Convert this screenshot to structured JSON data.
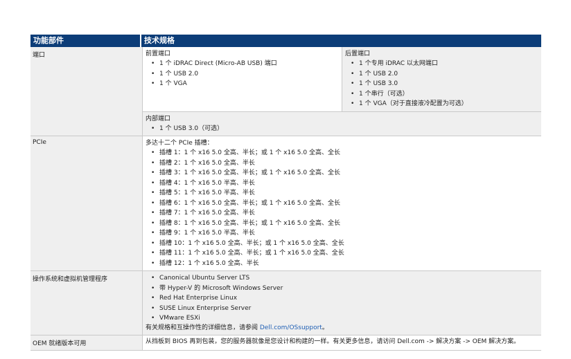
{
  "table": {
    "header": {
      "col1": "功能部件",
      "col2": "技术规格"
    },
    "ports": {
      "label": "端口",
      "front": {
        "title": "前置端口",
        "items": [
          "1 个 iDRAC Direct (Micro-AB USB) 端口",
          "1 个 USB 2.0",
          "1 个 VGA"
        ]
      },
      "rear": {
        "title": "后置端口",
        "items": [
          "1 个专用 iDRAC 以太网端口",
          "1 个 USB 2.0",
          "1 个 USB 3.0",
          "1 个串行（可选）",
          "1 个 VGA（对于直接液冷配置为可选）"
        ]
      },
      "internal": {
        "title": "内部端口",
        "items": [
          "1 个 USB 3.0（可选）"
        ]
      }
    },
    "pcie": {
      "label": "PCIe",
      "intro": "多达十二个 PCIe 插槽：",
      "slots": [
        "插槽 1：1 个 x16 5.0 全高、半长；或 1 个 x16 5.0 全高、全长",
        "插槽 2：1 个 x16 5.0 全高、半长",
        "插槽 3：1 个 x16 5.0 全高、半长；或 1 个 x16 5.0 全高、全长",
        "插槽 4：1 个 x16 5.0 半高、半长",
        "插槽 5：1 个 x16 5.0 半高、半长",
        "插槽 6：1 个 x16 5.0 全高、半长；或 1 个 x16 5.0 全高、全长",
        "插槽 7：1 个 x16 5.0 全高、半长",
        "插槽 8：1 个 x16 5.0 全高、半长；或 1 个 x16 5.0 全高、全长",
        "插槽 9：1 个 x16 5.0 半高、半长",
        "插槽 10：1 个 x16 5.0 全高、半长；或 1 个 x16 5.0 全高、全长",
        "插槽 11：1 个 x16 5.0 全高、半长；或 1 个 x16 5.0 全高、全长",
        "插槽 12：1 个 x16 5.0 全高、半长"
      ]
    },
    "os": {
      "label": "操作系统和虚拟机管理程序",
      "items": [
        "Canonical Ubuntu Server LTS",
        "带 Hyper-V 的 Microsoft Windows Server",
        "Red Hat Enterprise Linux",
        "SUSE Linux Enterprise Server",
        "VMware ESXi"
      ],
      "note_prefix": "有关规格和互操作性的详细信息，请参阅 ",
      "note_link": "Dell.com/OSsupport",
      "note_suffix": "。"
    },
    "oem": {
      "label": "OEM 就绪版本可用",
      "text": "从挡板到 BIOS 再到包装，您的服务器就像是您设计和构建的一样。有关更多信息，请访问 Dell.com -> 解决方案 -> OEM 解决方案。"
    }
  }
}
